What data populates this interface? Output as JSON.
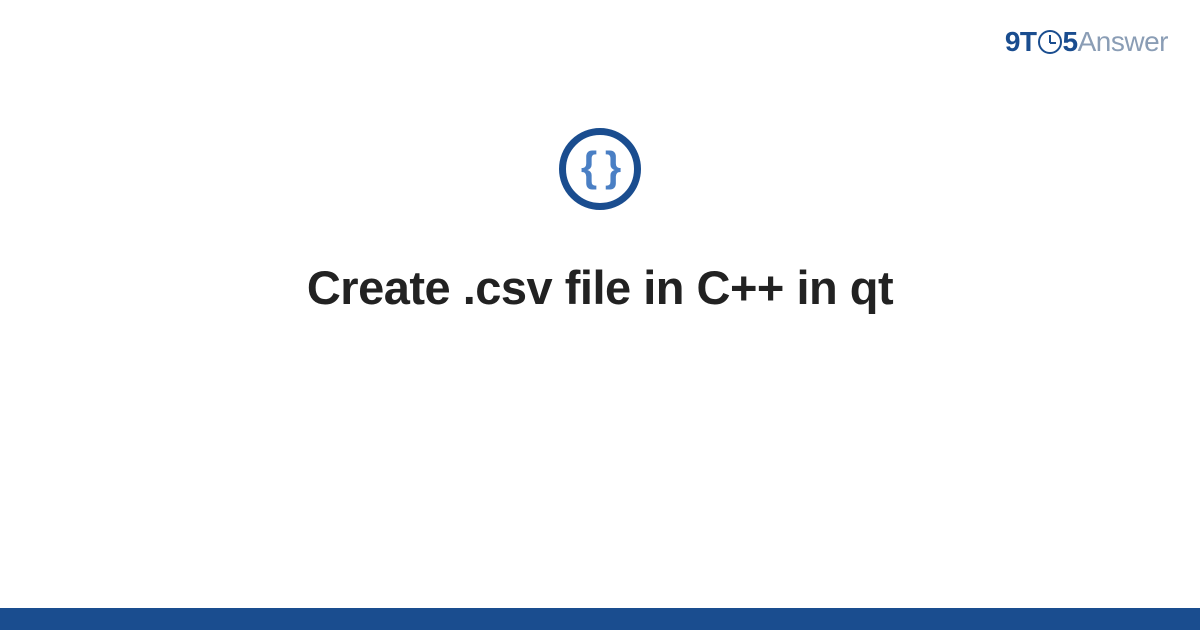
{
  "logo": {
    "prefix": "9T",
    "suffix": "5",
    "word": "Answer"
  },
  "icon": {
    "braces": "{ }"
  },
  "title": "Create .csv file in C++ in qt",
  "colors": {
    "brand_dark": "#1a4d8f",
    "brand_light": "#4a7fc4",
    "muted": "#8a9db5"
  }
}
